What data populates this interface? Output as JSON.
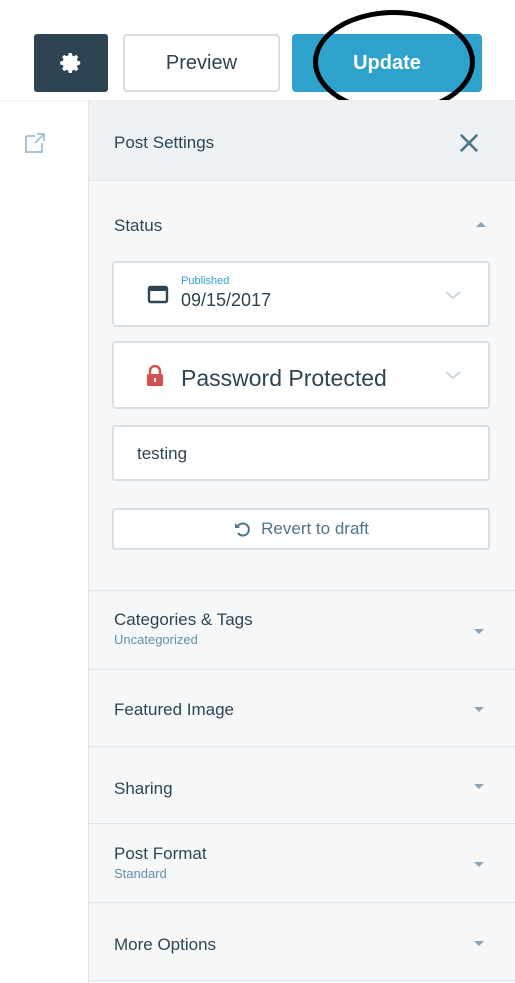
{
  "toolbar": {
    "settings_icon": "gear-icon",
    "preview_label": "Preview",
    "update_label": "Update"
  },
  "rail": {
    "external_icon": "external-link-icon"
  },
  "sidebar": {
    "title": "Post Settings",
    "close_icon": "close-icon",
    "status": {
      "label": "Status",
      "date_label": "Published",
      "date_value": "09/15/2017",
      "visibility_value": "Password Protected",
      "password_value": "testing",
      "revert_label": "Revert to draft"
    },
    "panels": [
      {
        "title": "Categories & Tags",
        "subtitle": "Uncategorized"
      },
      {
        "title": "Featured Image",
        "subtitle": ""
      },
      {
        "title": "Sharing",
        "subtitle": ""
      },
      {
        "title": "Post Format",
        "subtitle": "Standard"
      },
      {
        "title": "More Options",
        "subtitle": ""
      }
    ]
  },
  "colors": {
    "accent": "#2ea2cc",
    "dark": "#2e4453",
    "lock": "#d94f4f"
  }
}
